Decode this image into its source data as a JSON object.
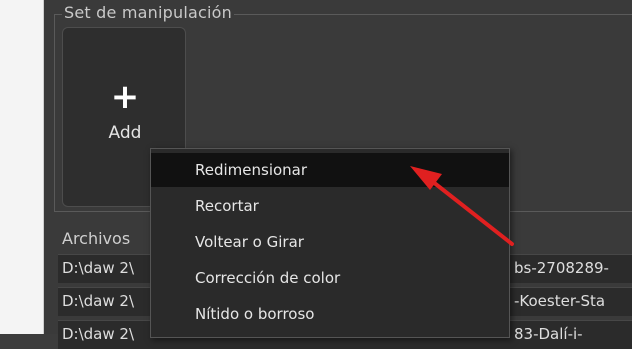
{
  "group": {
    "title": "Set de manipulación"
  },
  "add_tile": {
    "label": "Add"
  },
  "files": {
    "label": "Archivos",
    "rows": [
      {
        "path_start": "D:\\daw 2\\",
        "path_end": "bs-2708289-"
      },
      {
        "path_start": "D:\\daw 2\\",
        "path_end": "-Koester-Sta"
      },
      {
        "path_start": "D:\\daw 2\\",
        "path_end": "83-Dalí-i-"
      }
    ]
  },
  "context_menu": {
    "items": [
      {
        "label": "Redimensionar",
        "active": true
      },
      {
        "label": "Recortar",
        "active": false
      },
      {
        "label": "Voltear o Girar",
        "active": false
      },
      {
        "label": "Corrección de color",
        "active": false
      },
      {
        "label": "Nítido o borroso",
        "active": false
      }
    ]
  },
  "colors": {
    "menu_highlight": "#111111",
    "arrow": "#e02020",
    "panel": "#3a3a3a"
  }
}
